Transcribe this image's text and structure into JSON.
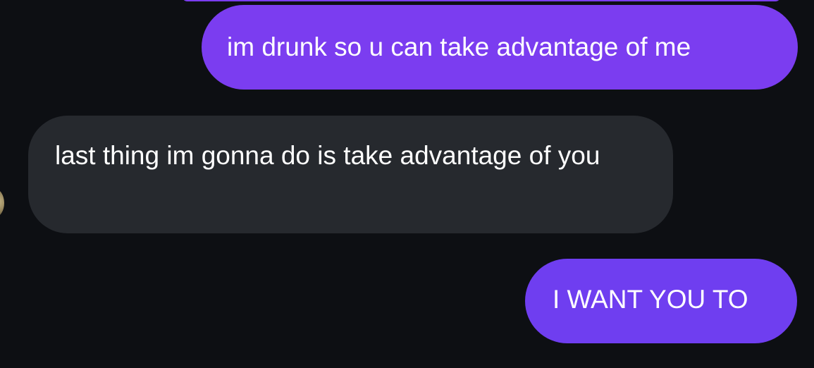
{
  "conversation": {
    "messages": [
      {
        "direction": "sent",
        "text": "im drunk so u can take advantage of me"
      },
      {
        "direction": "received",
        "text": "last thing im gonna do is take advantage of you"
      },
      {
        "direction": "sent",
        "text": "I WANT YOU TO"
      }
    ]
  },
  "colors": {
    "background": "#0d0f13",
    "sent_bubble": "#7b3df0",
    "received_bubble": "#26292e",
    "text": "#ffffff"
  }
}
